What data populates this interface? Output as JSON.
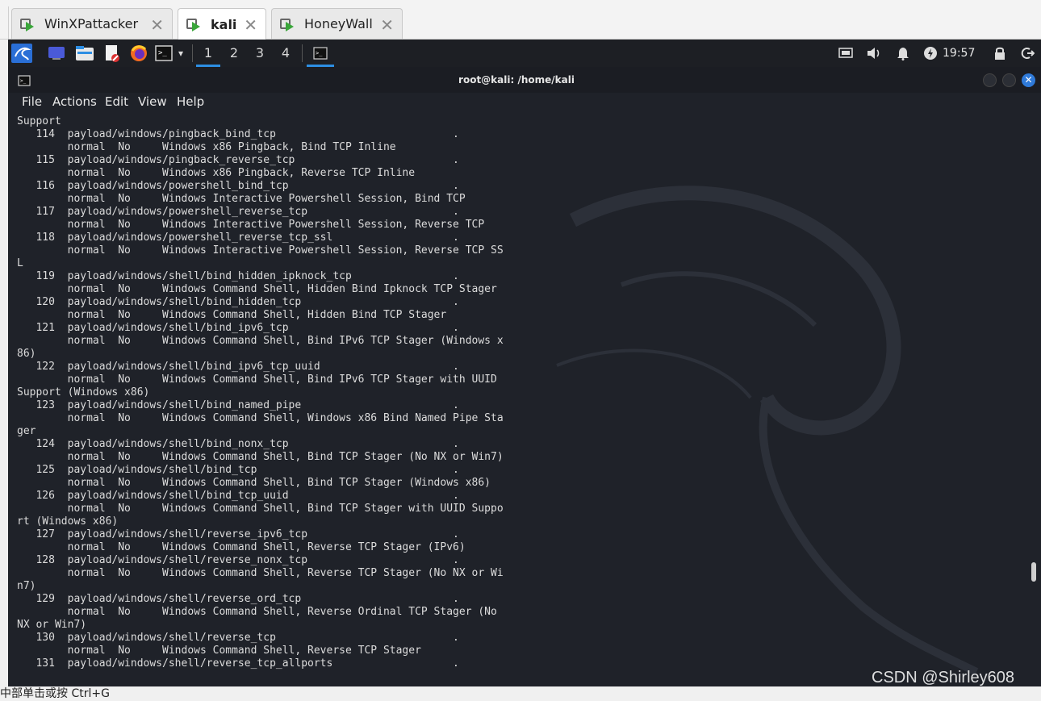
{
  "vm_tabs": [
    {
      "label": "WinXPattacker",
      "active": false
    },
    {
      "label": "kali",
      "active": true
    },
    {
      "label": "HoneyWall",
      "active": false
    }
  ],
  "panel": {
    "workspaces": [
      "1",
      "2",
      "3",
      "4"
    ],
    "active_workspace": "1",
    "clock": "19:57",
    "icons": [
      "kali-menu-icon",
      "desktop-icon",
      "file-manager-icon",
      "text-editor-icon",
      "firefox-icon",
      "terminal-icon",
      "chevron-down-icon",
      "terminal-task-icon",
      "network-icon",
      "volume-icon",
      "bell-icon",
      "power-manager-icon",
      "lock-icon",
      "logout-icon"
    ]
  },
  "terminal": {
    "title": "root@kali: /home/kali",
    "menu": [
      "File",
      "Actions",
      "Edit",
      "View",
      "Help"
    ],
    "lines": [
      "Support",
      "   114  payload/windows/pingback_bind_tcp                            .",
      "        normal  No     Windows x86 Pingback, Bind TCP Inline",
      "   115  payload/windows/pingback_reverse_tcp                         .",
      "        normal  No     Windows x86 Pingback, Reverse TCP Inline",
      "   116  payload/windows/powershell_bind_tcp                          .",
      "        normal  No     Windows Interactive Powershell Session, Bind TCP",
      "   117  payload/windows/powershell_reverse_tcp                       .",
      "        normal  No     Windows Interactive Powershell Session, Reverse TCP",
      "   118  payload/windows/powershell_reverse_tcp_ssl                   .",
      "        normal  No     Windows Interactive Powershell Session, Reverse TCP SS",
      "L",
      "   119  payload/windows/shell/bind_hidden_ipknock_tcp                .",
      "        normal  No     Windows Command Shell, Hidden Bind Ipknock TCP Stager",
      "   120  payload/windows/shell/bind_hidden_tcp                        .",
      "        normal  No     Windows Command Shell, Hidden Bind TCP Stager",
      "   121  payload/windows/shell/bind_ipv6_tcp                          .",
      "        normal  No     Windows Command Shell, Bind IPv6 TCP Stager (Windows x",
      "86)",
      "   122  payload/windows/shell/bind_ipv6_tcp_uuid                     .",
      "        normal  No     Windows Command Shell, Bind IPv6 TCP Stager with UUID",
      "Support (Windows x86)",
      "   123  payload/windows/shell/bind_named_pipe                        .",
      "        normal  No     Windows Command Shell, Windows x86 Bind Named Pipe Sta",
      "ger",
      "   124  payload/windows/shell/bind_nonx_tcp                          .",
      "        normal  No     Windows Command Shell, Bind TCP Stager (No NX or Win7)",
      "   125  payload/windows/shell/bind_tcp                               .",
      "        normal  No     Windows Command Shell, Bind TCP Stager (Windows x86)",
      "   126  payload/windows/shell/bind_tcp_uuid                          .",
      "        normal  No     Windows Command Shell, Bind TCP Stager with UUID Suppo",
      "rt (Windows x86)",
      "   127  payload/windows/shell/reverse_ipv6_tcp                       .",
      "        normal  No     Windows Command Shell, Reverse TCP Stager (IPv6)",
      "   128  payload/windows/shell/reverse_nonx_tcp                       .",
      "        normal  No     Windows Command Shell, Reverse TCP Stager (No NX or Wi",
      "n7)",
      "   129  payload/windows/shell/reverse_ord_tcp                        .",
      "        normal  No     Windows Command Shell, Reverse Ordinal TCP Stager (No",
      "NX or Win7)",
      "   130  payload/windows/shell/reverse_tcp                            .",
      "        normal  No     Windows Command Shell, Reverse TCP Stager",
      "   131  payload/windows/shell/reverse_tcp_allports                   ."
    ]
  },
  "host_hint": "中部单击或按 Ctrl+G",
  "watermark": "CSDN @Shirley608",
  "colors": {
    "terminal_bg": "#1f2229",
    "panel_bg": "#1d1f24",
    "accent": "#2d8ee3",
    "text": "#dcdcdc"
  }
}
